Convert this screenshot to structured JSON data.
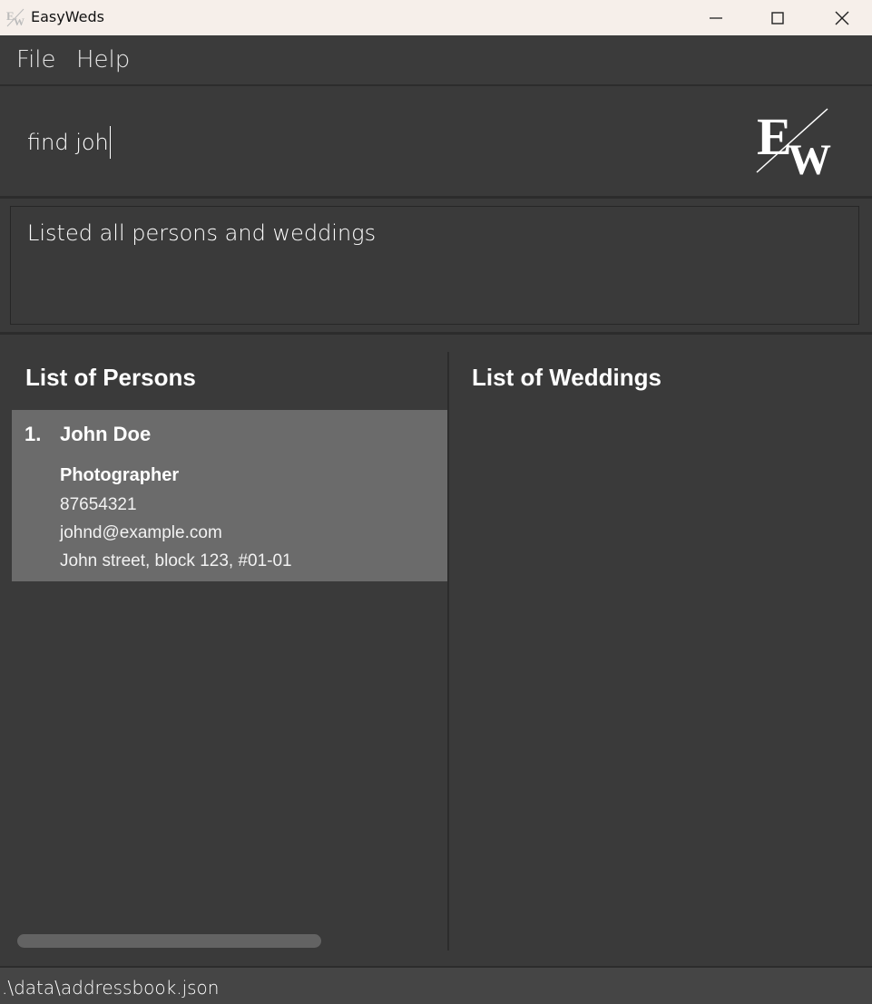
{
  "window": {
    "title": "EasyWeds",
    "app_icon": "easyweds-logo-icon",
    "controls": [
      "minimize-icon",
      "maximize-icon",
      "close-icon"
    ]
  },
  "menu": {
    "items": [
      {
        "label": "File"
      },
      {
        "label": "Help"
      }
    ]
  },
  "command": {
    "value": "find joh"
  },
  "logo": {
    "letters": "EW"
  },
  "result": {
    "message": "Listed all persons and weddings"
  },
  "persons": {
    "title": "List of Persons",
    "items": [
      {
        "index": "1.",
        "name": "John Doe",
        "role": "Photographer",
        "phone": "87654321",
        "email": "johnd@example.com",
        "address": "John street, block 123, #01-01"
      }
    ]
  },
  "weddings": {
    "title": "List of Weddings",
    "items": []
  },
  "status": {
    "path": ".\\data\\addressbook.json"
  },
  "colors": {
    "background": "#3a3a3a",
    "card": "#6b6b6b",
    "titlebar": "#f6efea"
  }
}
